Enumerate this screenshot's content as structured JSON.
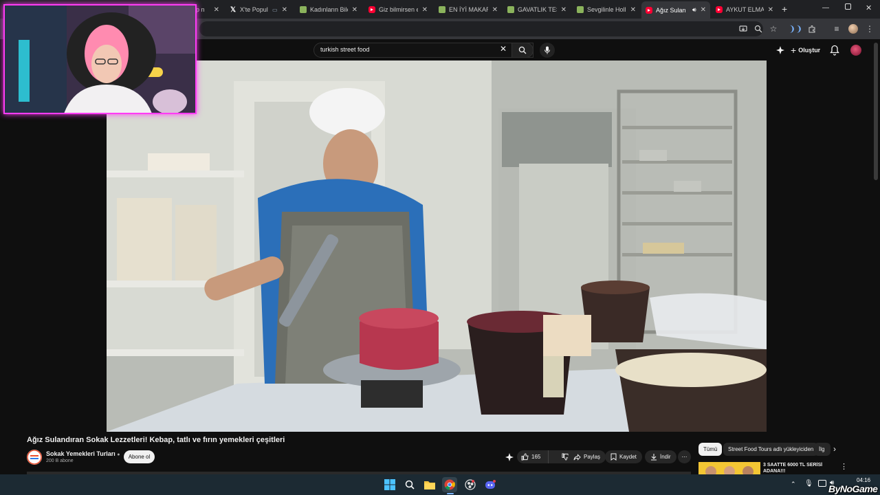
{
  "browser": {
    "tabs": [
      {
        "title": "p n",
        "favicon": "generic",
        "active": false
      },
      {
        "title": "X'te Popul",
        "favicon": "x-icon",
        "active": false,
        "extra_icon": "cast-icon"
      },
      {
        "title": "Kadınların Bile",
        "favicon": "game-icon",
        "active": false
      },
      {
        "title": "Giz bilmirsen e",
        "favicon": "youtube-icon",
        "active": false
      },
      {
        "title": "EN İYİ MAKARN",
        "favicon": "game-icon",
        "active": false
      },
      {
        "title": "GAVATLIK TEST",
        "favicon": "game-icon",
        "active": false
      },
      {
        "title": "Sevgilinle Holl",
        "favicon": "game-icon",
        "active": false
      },
      {
        "title": "Ağız Sulan",
        "favicon": "youtube-icon",
        "active": true,
        "audio": true
      },
      {
        "title": "AYKUT ELMAS",
        "favicon": "youtube-icon",
        "active": false
      }
    ],
    "new_tab_label": "+"
  },
  "youtube": {
    "search": {
      "value": "turkish street food"
    },
    "create_label": "Oluştur",
    "video": {
      "title": "Ağız Sulandıran Sokak Lezzetleri! Kebap, tatlı ve fırın yemekleri çeşitleri",
      "channel": {
        "name": "Sokak Yemekleri Turları",
        "subscribers": "200 B abone",
        "verified": true
      },
      "subscribe_label": "Abone ol",
      "likes": "165",
      "actions": {
        "share": "Paylaş",
        "save": "Kaydet",
        "download": "İndir",
        "more": "⋯"
      }
    },
    "chips": [
      {
        "label": "Tümü",
        "selected": true
      },
      {
        "label": "Street Food Tours adlı yükleyiciden",
        "selected": false
      },
      {
        "label": "İlg",
        "selected": false
      }
    ],
    "recommendation": {
      "title": "3 SAATTE 6000 TL SERİSİ ADANA!!!"
    }
  },
  "taskbar": {
    "time": "04:16",
    "watermark": "ByNoGame"
  },
  "colors": {
    "accent": "#ff0033",
    "webcam_border": "#ff3cf5",
    "taskbar": "#1c2a33"
  }
}
